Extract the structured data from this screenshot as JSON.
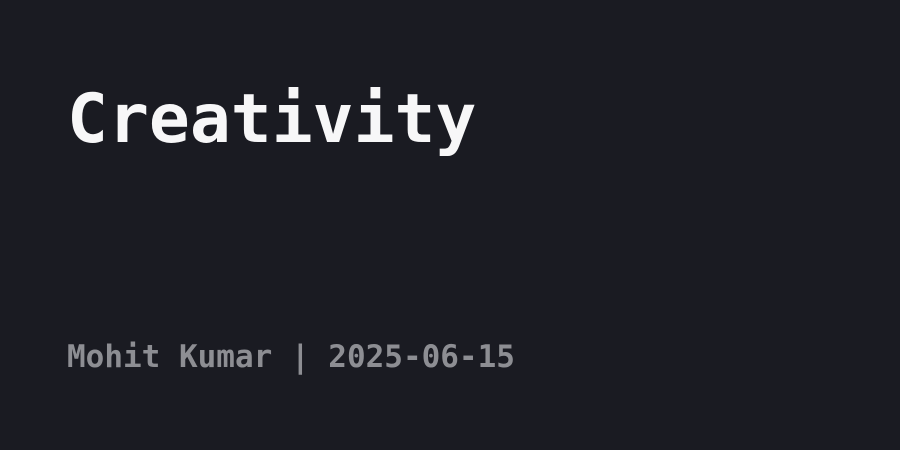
{
  "post": {
    "title": "Creativity",
    "byline": "Mohit Kumar | 2025-06-15"
  },
  "colors": {
    "background": "#1a1b22",
    "title": "#f7f7f8",
    "byline": "#8d8e93"
  }
}
